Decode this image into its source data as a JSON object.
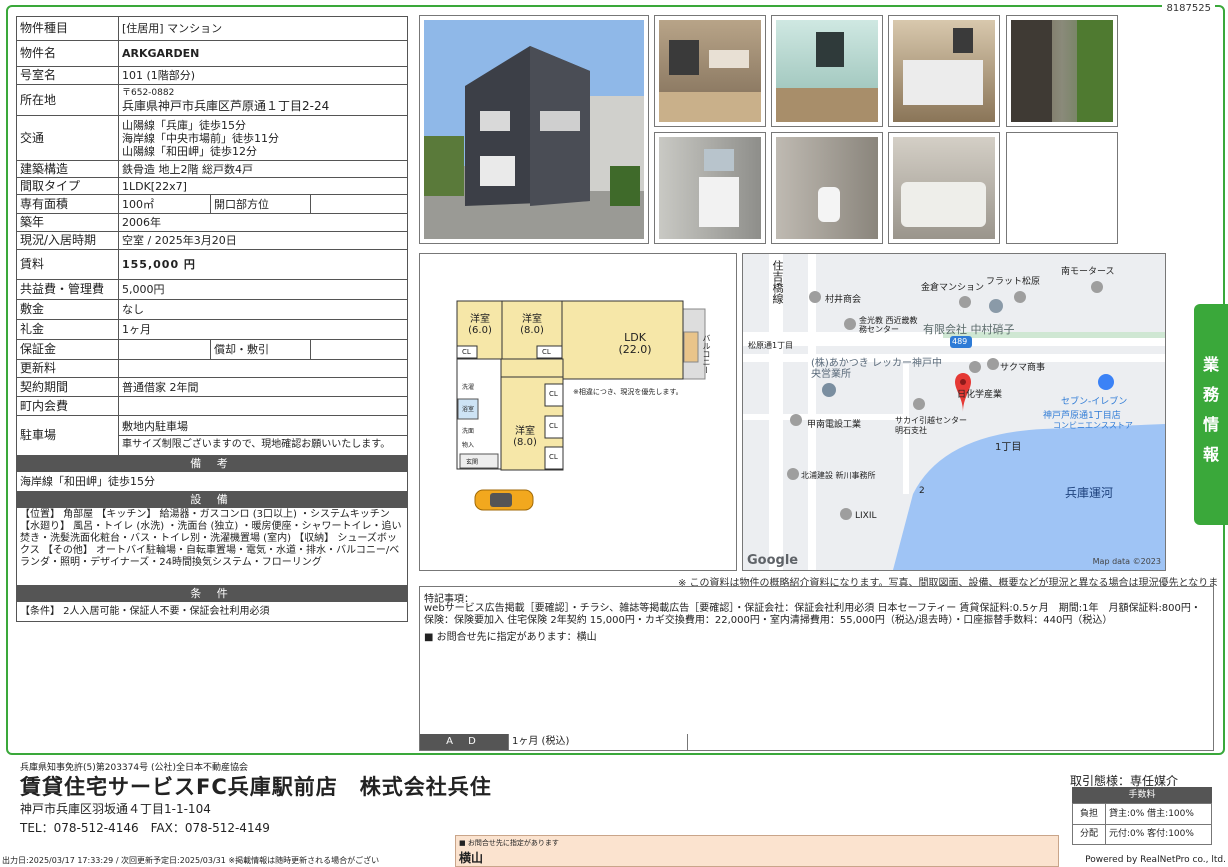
{
  "doc_id": "8187525",
  "property": {
    "type_label": "物件種目",
    "type_value": "[住居用] マンション",
    "name_label": "物件名",
    "name_value": "ARKGARDEN",
    "room_label": "号室名",
    "room_value": "101 (1階部分)",
    "address_label": "所在地",
    "postal": "〒652-0882",
    "address": "兵庫県神戸市兵庫区芦原通１丁目2-24",
    "access_label": "交通",
    "access": [
      "山陽線「兵庫」徒歩15分",
      "海岸線「中央市場前」徒歩11分",
      "山陽線「和田岬」徒歩12分"
    ],
    "structure_label": "建築構造",
    "structure_value": "鉄骨造 地上2階 総戸数4戸",
    "layout_label": "間取タイプ",
    "layout_value": "1LDK[22x7]",
    "area_label": "専有面積",
    "area_value": "100㎡",
    "direction_label": "開口部方位",
    "direction_value": "",
    "built_label": "築年",
    "built_value": "2006年",
    "status_label": "現況/入居時期",
    "status_value": "空室 / 2025年3月20日",
    "rent_label": "賃料",
    "rent_value": "155,000 円",
    "fee_label": "共益費・管理費",
    "fee_value": "5,000円",
    "deposit_label": "敷金",
    "deposit_value": "なし",
    "key_label": "礼金",
    "key_value": "1ヶ月",
    "guarantee_label": "保証金",
    "guarantee_value": "",
    "amort_label": "償却・敷引",
    "amort_value": "",
    "renew_label": "更新料",
    "renew_value": "",
    "contract_label": "契約期間",
    "contract_value": "普通借家 2年間",
    "town_label": "町内会費",
    "town_value": "",
    "parking_label": "駐車場",
    "parking_value": "敷地内駐車場",
    "parking_note": "車サイズ制限ございますので、現地確認お願いいたします。",
    "remarks_header": "備 考",
    "remarks": "海岸線「和田岬」徒歩15分",
    "equip_header": "設 備",
    "equip": "【位置】 角部屋 【キッチン】 給湯器・ガスコンロ (3口以上) ・システムキッチン 【水廻り】 風呂・トイレ (水洗) ・洗面台 (独立) ・暖房便座・シャワートイレ・追い焚き・洗髪洗面化粧台・バス・トイレ別・洗濯機置場 (室内) 【収納】 シューズボックス 【その他】 オートバイ駐輪場・自転車置場・電気・水道・排水・バルコニー/ベランダ・照明・デザイナーズ・24時間換気システム・フローリング",
    "cond_header": "条 件",
    "cond": "【条件】 2人入居可能・保証人不要・保証会社利用必須"
  },
  "floorplan": {
    "rooms": [
      {
        "name": "洋室",
        "size": "(6.0)"
      },
      {
        "name": "洋室",
        "size": "(8.0)"
      },
      {
        "name": "LDK",
        "size": "(22.0)"
      },
      {
        "name": "洋室",
        "size": "(8.0)"
      }
    ],
    "balcony": "バルコニー",
    "cl": "CL",
    "note": "※相違につき、現況を優先します。",
    "small": [
      "洗濯",
      "浴室",
      "洗面",
      "玄関",
      "物入"
    ]
  },
  "map": {
    "labels": [
      "住吉橋線",
      "村井商会",
      "金倉マンション",
      "フラット松原",
      "南モータース",
      "金光教 西近畿教務センター",
      "有限会社 中村硝子",
      "松原通1丁目",
      "(株)あかつき レッカー神戸中央営業所",
      "サクマ商事",
      "日化学産業",
      "セブン-イレブン",
      "神戸芦原通1丁目店",
      "コンビニエンスストア",
      "甲南電設工業",
      "サカイ引越センター 明石支社",
      "1丁目",
      "北浦建設 新川事務所",
      "兵庫運河",
      "LIXIL",
      "2"
    ],
    "route": "489",
    "google": "Google",
    "copyright": "Map data ©2023"
  },
  "side_tab": [
    "業",
    "務",
    "情",
    "報"
  ],
  "notice": "※ この資料は物件の概略紹介資料になります。写真、間取図面、設備、概要などが現況と異なる場合は現況優先となります。",
  "special": {
    "title": "特記事項：",
    "body": "webサービス広告掲載［要確認］・チラシ、雑誌等掲載広告［要確認］・保証会社：保証会社利用必須 日本セーフティー 賃貸保証料:0.5ヶ月　期間:1年　月額保証料:800円・保険：保険要加入 住宅保険 2年契約 15,000円・カギ交換費用：22,000円・室内清掃費用：55,000円（税込/退去時）・口座振替手数料：440円（税込）",
    "contact": "■ お問合せ先に指定があります：横山",
    "ad_label": "A D",
    "ad_value": "1ヶ月 (税込)"
  },
  "footer": {
    "license": "兵庫県知事免許(5)第203374号 (公社)全日本不動産協会",
    "company": "賃貸住宅サービスFC兵庫駅前店　株式会社兵住",
    "address": "神戸市兵庫区羽坂通４丁目1-1-104",
    "tel": "TEL：078-512-4146　FAX：078-512-4149",
    "deal": "取引態様：専任媒介",
    "fee_header": "手数料",
    "burden_label": "負担",
    "burden_value": "貸主:0% 借主:100%",
    "split_label": "分配",
    "split_value": "元付:0% 客付:100%",
    "contact_small": "■ お問合せ先に指定があります",
    "contact_name": "横山",
    "printed": "出力日:2025/03/17 17:33:29 / 次回更新予定日:2025/03/31 ※掲載情報は随時更新される場合がござい",
    "powered": "Powered by RealNetPro co., ltd."
  }
}
